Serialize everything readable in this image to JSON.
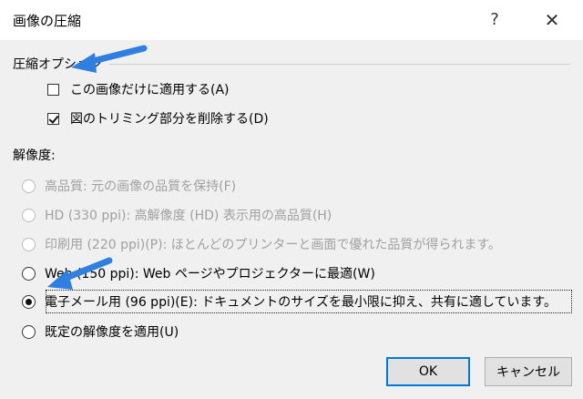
{
  "window": {
    "title": "画像の圧縮",
    "help_label": "?",
    "close_label": "✕"
  },
  "compression": {
    "heading": "圧縮オプション",
    "apply_only_label": "この画像だけに適用する(A)",
    "apply_only_checked": false,
    "delete_cropped_label": "図のトリミング部分を削除する(D)",
    "delete_cropped_checked": true
  },
  "resolution": {
    "heading": "解像度:",
    "options": [
      {
        "label": "高品質: 元の画像の品質を保持(F)",
        "enabled": false,
        "selected": false
      },
      {
        "label": "HD (330 ppi): 高解像度 (HD) 表示用の高品質(H)",
        "enabled": false,
        "selected": false
      },
      {
        "label": "印刷用 (220 ppi)(P): ほとんどのプリンターと画面で優れた品質が得られます。",
        "enabled": false,
        "selected": false
      },
      {
        "label": "Web (150 ppi): Web ページやプロジェクターに最適(W)",
        "enabled": true,
        "selected": false
      },
      {
        "label": "電子メール用 (96 ppi)(E): ドキュメントのサイズを最小限に抑え、共有に適しています。",
        "enabled": true,
        "selected": true
      },
      {
        "label": "既定の解像度を適用(U)",
        "enabled": true,
        "selected": false
      }
    ]
  },
  "buttons": {
    "ok_label": "OK",
    "cancel_label": "キャンセル"
  },
  "colors": {
    "accent": "#0078d7",
    "annotation_arrow": "#2f7fe0"
  }
}
